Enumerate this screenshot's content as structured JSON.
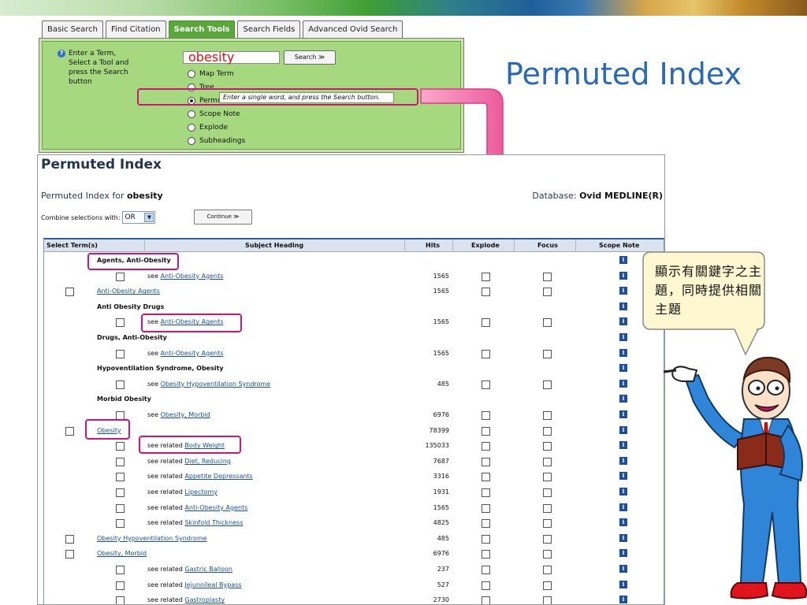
{
  "slide": {
    "title": "Permuted Index"
  },
  "search": {
    "tabs": [
      {
        "label": "Basic Search",
        "active": false
      },
      {
        "label": "Find Citation",
        "active": false
      },
      {
        "label": "Search Tools",
        "active": true
      },
      {
        "label": "Search Fields",
        "active": false
      },
      {
        "label": "Advanced Ovid Search",
        "active": false
      }
    ],
    "help_icon": "question-icon",
    "instructions": "Enter a Term, Select a Tool and press the Search button",
    "term_value": "obesity",
    "search_button": "Search ≫",
    "tools": [
      {
        "label": "Map Term",
        "selected": false
      },
      {
        "label": "Tree",
        "selected": false
      },
      {
        "label": "Permuted Index",
        "selected": true
      },
      {
        "label": "Scope Note",
        "selected": false
      },
      {
        "label": "Explode",
        "selected": false
      },
      {
        "label": "Subheadings",
        "selected": false
      }
    ],
    "hint": "Enter a single word, and press the Search button."
  },
  "results": {
    "title": "Permuted Index",
    "for_prefix": "Permuted Index for ",
    "for_term": "obesity",
    "database_prefix": "Database: ",
    "database_name": "Ovid MEDLINE(R)",
    "combine_label": "Combine selections with:",
    "combine_value": "OR",
    "continue_button": "Continue ≫",
    "columns": [
      "Select Term(s)",
      "Subject Heading",
      "Hits",
      "Explode",
      "Focus",
      "Scope Note"
    ],
    "rows": [
      {
        "kind": "heading",
        "text": "Agents, Anti-Obesity",
        "hits": ""
      },
      {
        "kind": "see",
        "prefix": "see ",
        "link": "Anti-Obesity Agents",
        "hits": "1565"
      },
      {
        "kind": "term",
        "link": "Anti-Obesity Agents",
        "hits": "1565"
      },
      {
        "kind": "heading",
        "text": "Anti Obesity Drugs",
        "hits": ""
      },
      {
        "kind": "see",
        "prefix": "see ",
        "link": "Anti-Obesity Agents",
        "hits": "1565"
      },
      {
        "kind": "heading",
        "text": "Drugs, Anti-Obesity",
        "hits": ""
      },
      {
        "kind": "see",
        "prefix": "see ",
        "link": "Anti-Obesity Agents",
        "hits": "1565"
      },
      {
        "kind": "heading",
        "text": "Hypoventilation Syndrome, Obesity",
        "hits": ""
      },
      {
        "kind": "see",
        "prefix": "see ",
        "link": "Obesity Hypoventilation Syndrome",
        "hits": "485"
      },
      {
        "kind": "heading",
        "text": "Morbid Obesity",
        "hits": ""
      },
      {
        "kind": "see",
        "prefix": "see ",
        "link": "Obesity, Morbid",
        "hits": "6976"
      },
      {
        "kind": "term",
        "link": "Obesity",
        "hits": "78399"
      },
      {
        "kind": "see",
        "prefix": "see related ",
        "link": "Body Weight",
        "hits": "135033"
      },
      {
        "kind": "see",
        "prefix": "see related ",
        "link": "Diet, Reducing",
        "hits": "7687"
      },
      {
        "kind": "see",
        "prefix": "see related ",
        "link": "Appetite Depressants",
        "hits": "3316"
      },
      {
        "kind": "see",
        "prefix": "see related ",
        "link": "Lipectomy",
        "hits": "1931"
      },
      {
        "kind": "see",
        "prefix": "see related ",
        "link": "Anti-Obesity Agents",
        "hits": "1565"
      },
      {
        "kind": "see",
        "prefix": "see related ",
        "link": "Skinfold Thickness",
        "hits": "4825"
      },
      {
        "kind": "term",
        "link": "Obesity Hypoventilation Syndrome",
        "hits": "485"
      },
      {
        "kind": "term",
        "link": "Obesity, Morbid",
        "hits": "6976"
      },
      {
        "kind": "see",
        "prefix": "see related ",
        "link": "Gastric Balloon",
        "hits": "237"
      },
      {
        "kind": "see",
        "prefix": "see related ",
        "link": "Jejunoileal Bypass",
        "hits": "527"
      },
      {
        "kind": "see",
        "prefix": "see related ",
        "link": "Gastroplasty",
        "hits": "2730"
      }
    ]
  },
  "callout": {
    "text": "顯示有關鍵字之主題，同時提供相關主題"
  },
  "colors": {
    "accent_pink": "#d0157a",
    "title_blue": "#2a68b8",
    "arrow_pink": "#f06aa8"
  }
}
